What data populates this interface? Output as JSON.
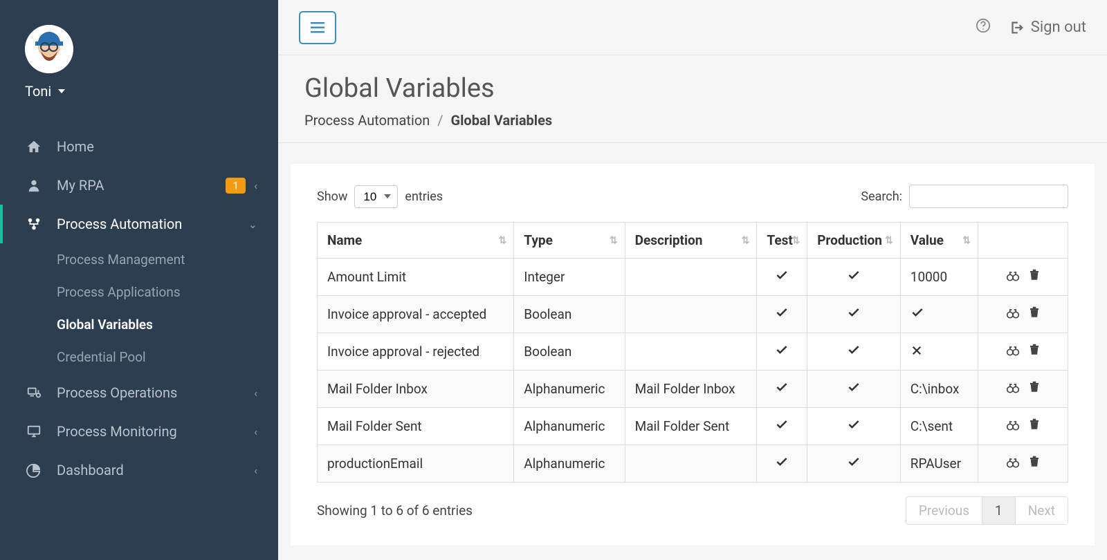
{
  "user": {
    "name": "Toni"
  },
  "sidebar": {
    "items": [
      {
        "label": "Home",
        "icon": "home"
      },
      {
        "label": "My RPA",
        "icon": "user",
        "badge": "1",
        "chevron": "left"
      },
      {
        "label": "Process Automation",
        "icon": "automation",
        "chevron": "down",
        "children": [
          {
            "label": "Process Management"
          },
          {
            "label": "Process Applications"
          },
          {
            "label": "Global Variables",
            "active": true
          },
          {
            "label": "Credential Pool"
          }
        ]
      },
      {
        "label": "Process Operations",
        "icon": "operations",
        "chevron": "left"
      },
      {
        "label": "Process Monitoring",
        "icon": "monitor",
        "chevron": "left"
      },
      {
        "label": "Dashboard",
        "icon": "pie",
        "chevron": "left"
      }
    ]
  },
  "topbar": {
    "signout": "Sign out"
  },
  "page": {
    "title": "Global Variables",
    "breadcrumb": {
      "parent": "Process Automation",
      "current": "Global Variables"
    }
  },
  "table": {
    "show_label": "Show",
    "entries_label": "entries",
    "page_size": "10",
    "search_label": "Search:",
    "columns": [
      "Name",
      "Type",
      "Description",
      "Test",
      "Production",
      "Value"
    ],
    "rows": [
      {
        "name": "Amount Limit",
        "type": "Integer",
        "description": "",
        "test": true,
        "production": true,
        "value": "10000"
      },
      {
        "name": "Invoice approval - accepted",
        "type": "Boolean",
        "description": "",
        "test": true,
        "production": true,
        "value": true
      },
      {
        "name": "Invoice approval - rejected",
        "type": "Boolean",
        "description": "",
        "test": true,
        "production": true,
        "value": false
      },
      {
        "name": "Mail Folder Inbox",
        "type": "Alphanumeric",
        "description": "Mail Folder Inbox",
        "test": true,
        "production": true,
        "value": "C:\\inbox"
      },
      {
        "name": "Mail Folder Sent",
        "type": "Alphanumeric",
        "description": "Mail Folder Sent",
        "test": true,
        "production": true,
        "value": "C:\\sent"
      },
      {
        "name": "productionEmail",
        "type": "Alphanumeric",
        "description": "",
        "test": true,
        "production": true,
        "value": "RPAUser"
      }
    ],
    "info": "Showing 1 to 6 of 6 entries",
    "prev": "Previous",
    "next": "Next",
    "page": "1"
  }
}
